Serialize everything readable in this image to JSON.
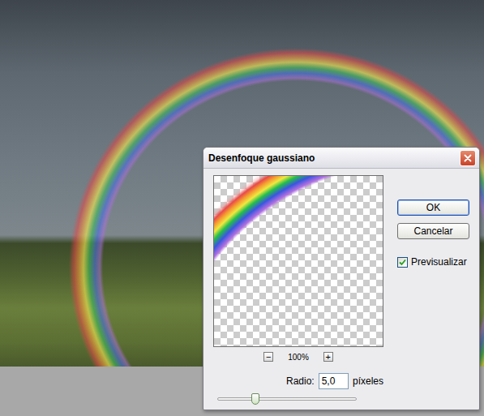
{
  "window": {
    "title": "Desenfoque gaussiano"
  },
  "zoom": {
    "out": "−",
    "value": "100%",
    "in": "+"
  },
  "buttons": [
    {
      "label": "OK",
      "default": true
    },
    {
      "label": "Cancelar",
      "default": false
    }
  ],
  "preview": {
    "label": "Previsualizar",
    "checked": true
  },
  "radius": {
    "label": "Radio:",
    "value": "5,0",
    "unit": "píxeles",
    "level": 0.27
  }
}
